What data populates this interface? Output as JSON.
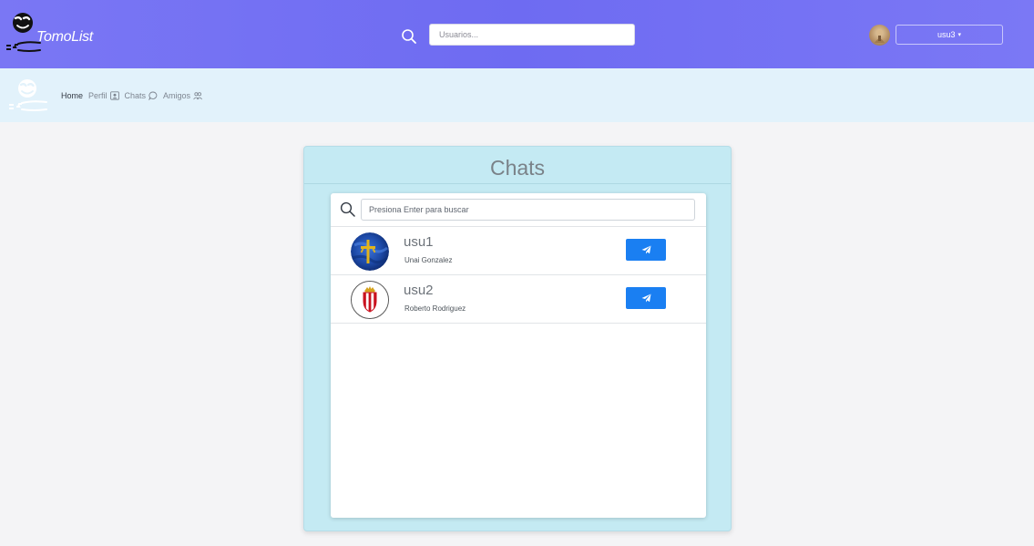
{
  "app": {
    "logo_text": "TomoList"
  },
  "header": {
    "search": {
      "placeholder": "Usuarios..."
    },
    "user_menu": {
      "label": "usu3",
      "caret": "▾"
    }
  },
  "nav": {
    "items": [
      {
        "label": "Home",
        "icon": "",
        "active": true
      },
      {
        "label": "Perfil",
        "icon": "profile-card-icon"
      },
      {
        "label": "Chats",
        "icon": "chat-bubble-icon"
      },
      {
        "label": "Amigos",
        "icon": "friends-icon"
      }
    ]
  },
  "chats": {
    "title": "Chats",
    "search": {
      "placeholder": "Presiona Enter para buscar"
    },
    "list": [
      {
        "username": "usu1",
        "full_name": "Unai Gonzalez",
        "avatar": "asturias-flag-avatar"
      },
      {
        "username": "usu2",
        "full_name": "Roberto Rodriguez",
        "avatar": "sporting-crest-avatar"
      }
    ],
    "action_icon": "send-icon"
  },
  "colors": {
    "header_bg": "#726ff3",
    "subnav_bg": "#e2f2fb",
    "panel_bg": "#c4eaf3",
    "button_primary": "#1a7ff2"
  }
}
